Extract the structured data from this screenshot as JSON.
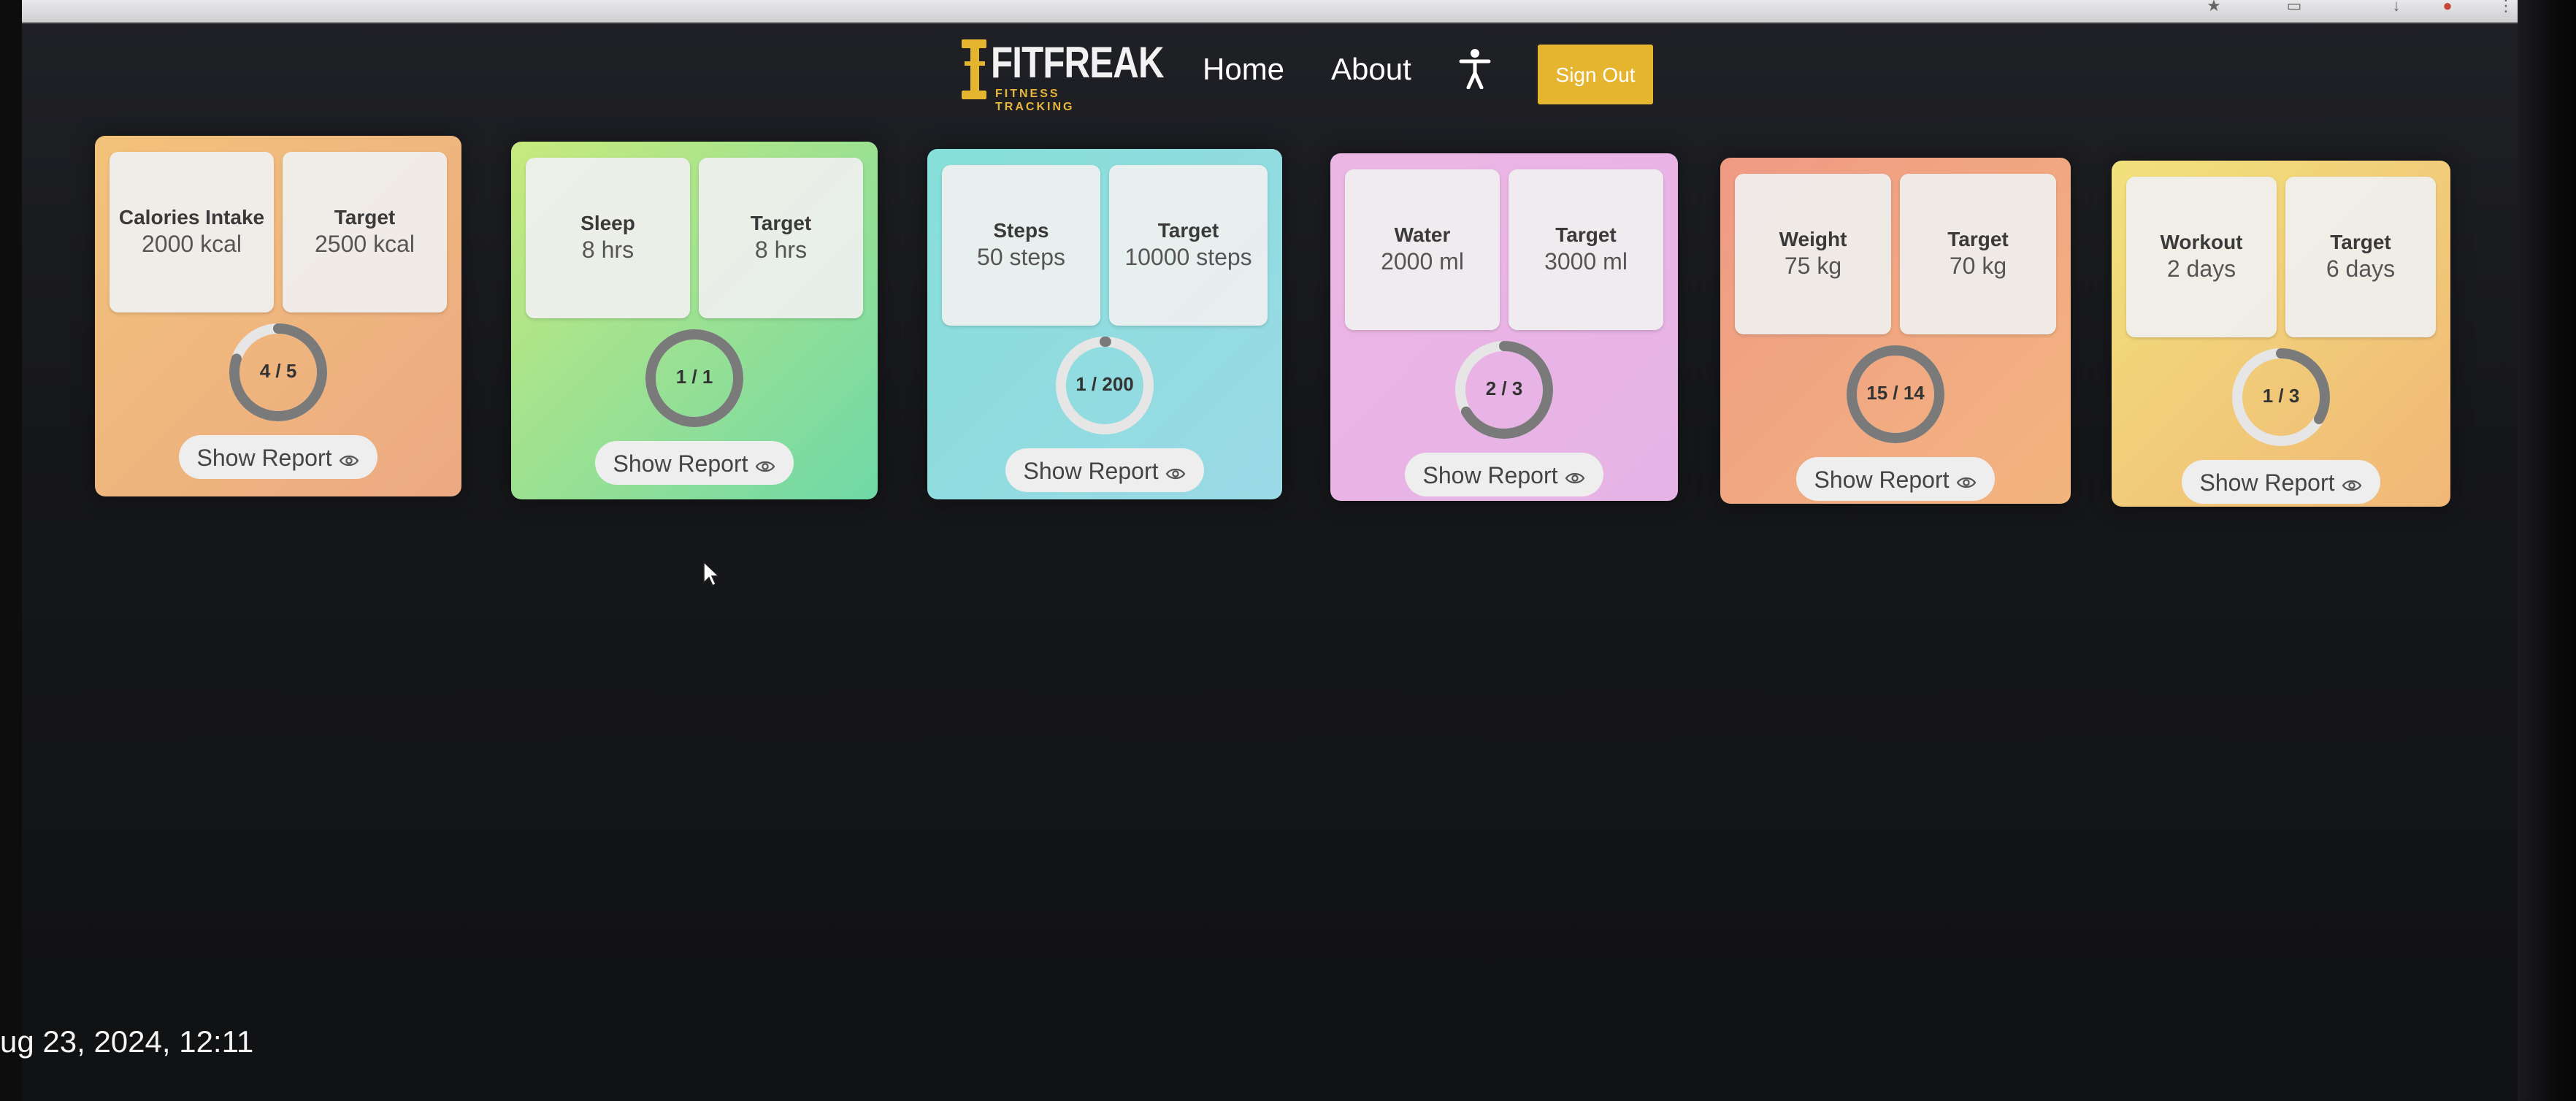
{
  "nav": {
    "logo_text": "FITFREAK",
    "logo_sub": "FITNESS TRACKING",
    "home": "Home",
    "about": "About",
    "accessibility_icon": "person-standing-icon",
    "sign_out": "Sign Out",
    "sign_out_color": "#e5b530"
  },
  "cards": [
    {
      "metric_label": "Calories Intake",
      "metric_value": "2000 kcal",
      "target_label": "Target",
      "target_value": "2500 kcal",
      "progress_text": "4 / 5",
      "progress_fraction": 0.8,
      "report_label": "Show Report",
      "color_a": "#f2c27a",
      "color_b": "#eca982"
    },
    {
      "metric_label": "Sleep",
      "metric_value": "8 hrs",
      "target_label": "Target",
      "target_value": "8 hrs",
      "progress_text": "1 / 1",
      "progress_fraction": 1.0,
      "report_label": "Show Report",
      "color_a": "#c8ea7d",
      "color_b": "#6fd8a7"
    },
    {
      "metric_label": "Steps",
      "metric_value": "50 steps",
      "target_label": "Target",
      "target_value": "10000 steps",
      "progress_text": "1 / 200",
      "progress_fraction": 0.005,
      "report_label": "Show Report",
      "color_a": "#86dfd9",
      "color_b": "#9ad9e6"
    },
    {
      "metric_label": "Water",
      "metric_value": "2000 ml",
      "target_label": "Target",
      "target_value": "3000 ml",
      "progress_text": "2 / 3",
      "progress_fraction": 0.667,
      "report_label": "Show Report",
      "color_a": "#ecb6e4",
      "color_b": "#e6b3e6"
    },
    {
      "metric_label": "Weight",
      "metric_value": "75 kg",
      "target_label": "Target",
      "target_value": "70 kg",
      "progress_text": "15 / 14",
      "progress_fraction": 1.0,
      "report_label": "Show Report",
      "color_a": "#f09a84",
      "color_b": "#f2b57f"
    },
    {
      "metric_label": "Workout",
      "metric_value": "2 days",
      "target_label": "Target",
      "target_value": "6 days",
      "progress_text": "1 / 3",
      "progress_fraction": 0.333,
      "report_label": "Show Report",
      "color_a": "#f1e27b",
      "color_b": "#f1b677"
    }
  ],
  "taskbar": {
    "timestamp": "ug 23, 2024, 12:11"
  },
  "colors": {
    "ring_track": "#e6e6e6",
    "ring_fill": "#7a7a7a"
  }
}
